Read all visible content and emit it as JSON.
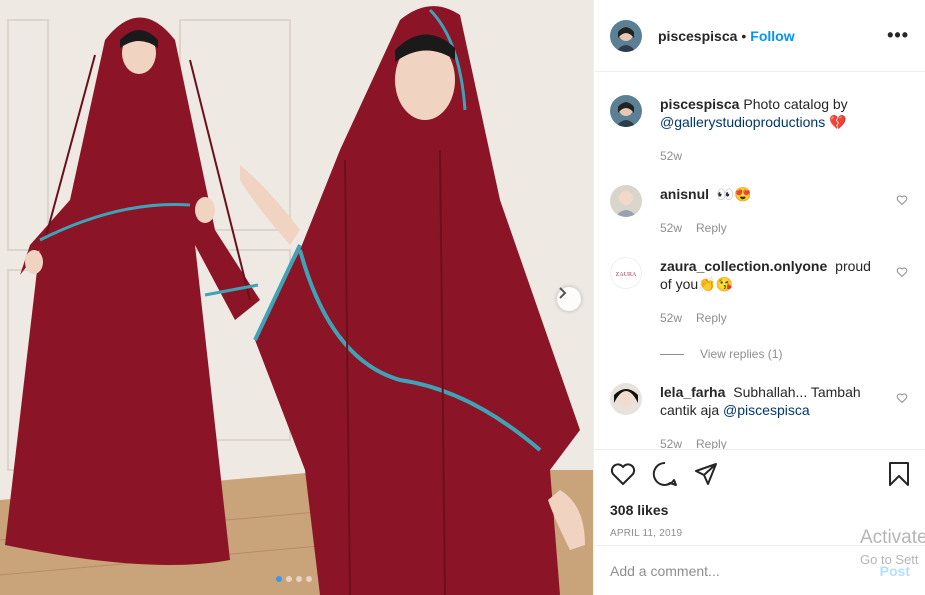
{
  "post": {
    "username": "piscespisca",
    "dot": "•",
    "follow_label": "Follow",
    "more_label": "•••",
    "image_dots": 4,
    "active_dot": 0
  },
  "caption": {
    "username": "piscespisca",
    "text": "Photo catalog by",
    "mention": "@gallerystudioproductions",
    "emoji": "💔",
    "time": "52w"
  },
  "comments": [
    {
      "username": "anisnul",
      "text": "👀😍",
      "time": "52w",
      "reply_label": "Reply"
    },
    {
      "username": "zaura_collection.onlyone",
      "text": "proud of you👏😘",
      "time": "52w",
      "reply_label": "Reply"
    },
    {
      "username": "lela_farha",
      "text": "Subhallah... Tambah cantik aja",
      "mention": "@piscespisca",
      "time": "52w",
      "reply_label": "Reply"
    }
  ],
  "view_replies_label": "View replies (1)",
  "zaura_logo_text": "ZAURA",
  "likes_label": "308 likes",
  "date_label": "APRIL 11, 2019",
  "add_comment": {
    "placeholder": "Add a comment...",
    "post_label": "Post"
  },
  "watermark": {
    "line1": "Activate",
    "line2": "Go to Sett"
  },
  "colors": {
    "accent": "#0095f6",
    "dress": "#8b1526",
    "trim": "#3fa3b8"
  }
}
